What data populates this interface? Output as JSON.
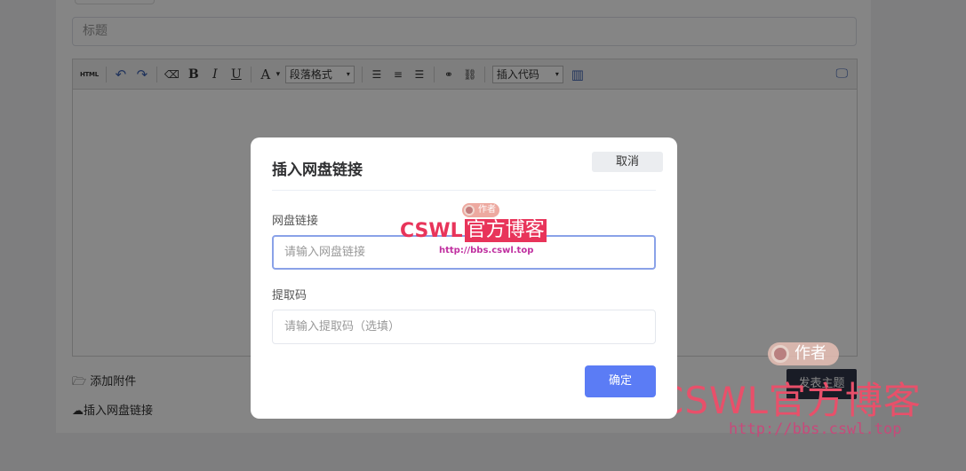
{
  "form": {
    "title_placeholder": "标题",
    "attach_label": "添加附件",
    "netdisk_label": "插入网盘链接",
    "publish_label": "发表主题"
  },
  "toolbar": {
    "html_label": "HTML",
    "undo_icon": "↶",
    "redo_icon": "↷",
    "eraser_icon": "⌫",
    "bold": "B",
    "italic": "I",
    "underline": "U",
    "fontcolor": "A",
    "fontcolor_arrow": "▾",
    "paragraph_select": "段落格式",
    "align_left_icon": "☰",
    "align_center_icon": "≡",
    "align_right_icon": "☰",
    "link_icon": "⚭",
    "unlink_icon": "⛓",
    "insert_code_select": "插入代码",
    "film_icon": "▥",
    "fullscreen_icon": "🖵"
  },
  "modal": {
    "title": "插入网盘链接",
    "cancel_label": "取消",
    "link_label": "网盘链接",
    "link_placeholder": "请输入网盘链接",
    "code_label": "提取码",
    "code_placeholder": "请输入提取码（选填）",
    "confirm_label": "确定"
  },
  "watermark": {
    "badge": "作者",
    "brand_latin": "CSWL",
    "brand_cn": "官方博客",
    "url": "http://bbs.cswl.top"
  },
  "colors": {
    "primary": "#5b7cf5",
    "watermark_red": "#e8345a",
    "publish_bg": "#30374a"
  }
}
